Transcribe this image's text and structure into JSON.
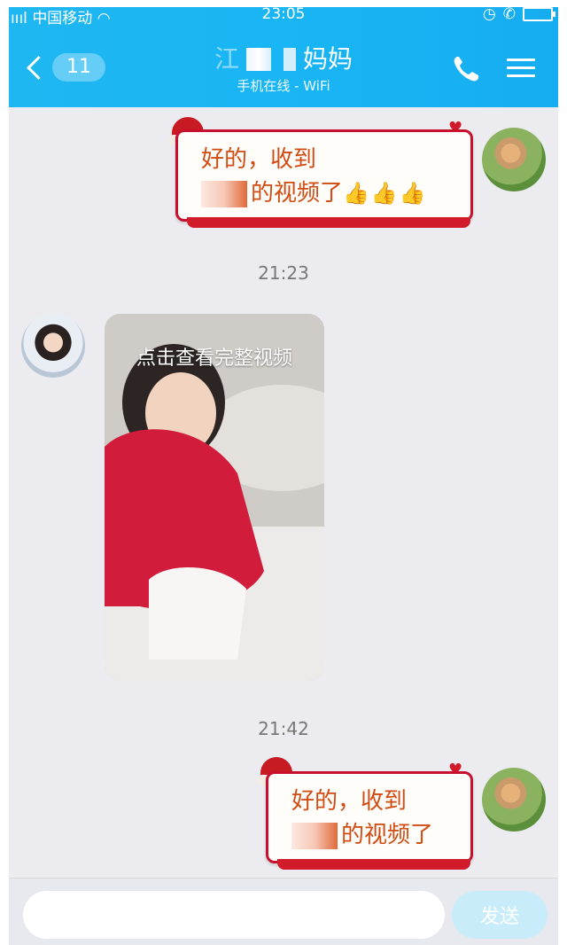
{
  "status_bar": {
    "carrier": "中国移动",
    "time": "23:05"
  },
  "header": {
    "unread_count": "11",
    "contact_name_prefix": "江",
    "contact_name_suffix": "妈妈",
    "contact_status": "手机在线 - WiFi"
  },
  "messages": [
    {
      "type": "text",
      "side": "right",
      "line1": "好的，收到",
      "line2": "的视频了",
      "emoji": "👍👍👍"
    },
    {
      "type": "timestamp",
      "text": "21:23"
    },
    {
      "type": "video",
      "side": "left",
      "label": "点击查看完整视频"
    },
    {
      "type": "timestamp",
      "text": "21:42"
    },
    {
      "type": "text",
      "side": "right",
      "line1": "好的，收到",
      "line2": "的视频了"
    }
  ],
  "input_bar": {
    "placeholder": "",
    "send_label": "发送"
  },
  "colors": {
    "header_blue": "#19b5f4",
    "bubble_text": "#d14b12",
    "bubble_border": "#c8102e",
    "chat_bg": "#ebebf0"
  }
}
